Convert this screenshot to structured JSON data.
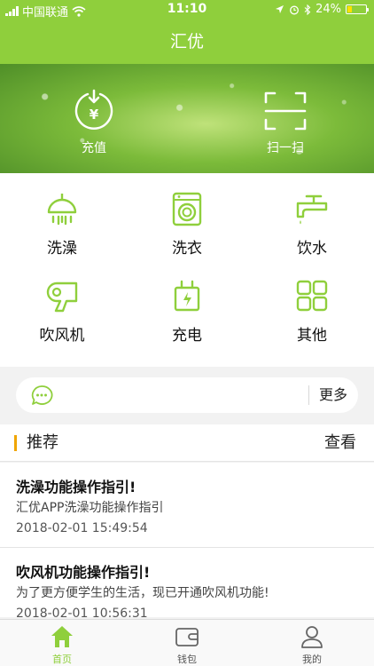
{
  "status_bar": {
    "carrier": "中国联通",
    "time": "11:10",
    "battery_text": "24%",
    "battery_level": 0.24,
    "icons": [
      "signal-icon",
      "wifi-icon",
      "location-icon",
      "alarm-icon",
      "bluetooth-icon",
      "battery-icon"
    ]
  },
  "nav": {
    "title": "汇优"
  },
  "banner": {
    "recharge_label": "充值",
    "scan_label": "扫一扫"
  },
  "services": [
    {
      "label": "洗澡",
      "icon": "shower-icon"
    },
    {
      "label": "洗衣",
      "icon": "washing-machine-icon"
    },
    {
      "label": "饮水",
      "icon": "faucet-icon"
    },
    {
      "label": "吹风机",
      "icon": "hair-dryer-icon"
    },
    {
      "label": "充电",
      "icon": "charger-icon"
    },
    {
      "label": "其他",
      "icon": "grid-icon"
    }
  ],
  "notice": {
    "icon": "message-bubble-icon",
    "more_label": "更多"
  },
  "recommend": {
    "title": "推荐",
    "view_label": "查看"
  },
  "articles": [
    {
      "title": "洗澡功能操作指引!",
      "desc": "汇优APP洗澡功能操作指引",
      "time": "2018-02-01 15:49:54"
    },
    {
      "title": "吹风机功能操作指引!",
      "desc": "为了更方便学生的生活，现已开通吹风机功能!",
      "time": "2018-02-01 10:56:31"
    }
  ],
  "tabs": [
    {
      "label": "首页",
      "icon": "home-icon",
      "active": true
    },
    {
      "label": "钱包",
      "icon": "wallet-icon",
      "active": false
    },
    {
      "label": "我的",
      "icon": "user-icon",
      "active": false
    }
  ],
  "colors": {
    "accent": "#8fcf3c",
    "highlight_bar": "#f0a500",
    "background": "#f2f2f2"
  }
}
